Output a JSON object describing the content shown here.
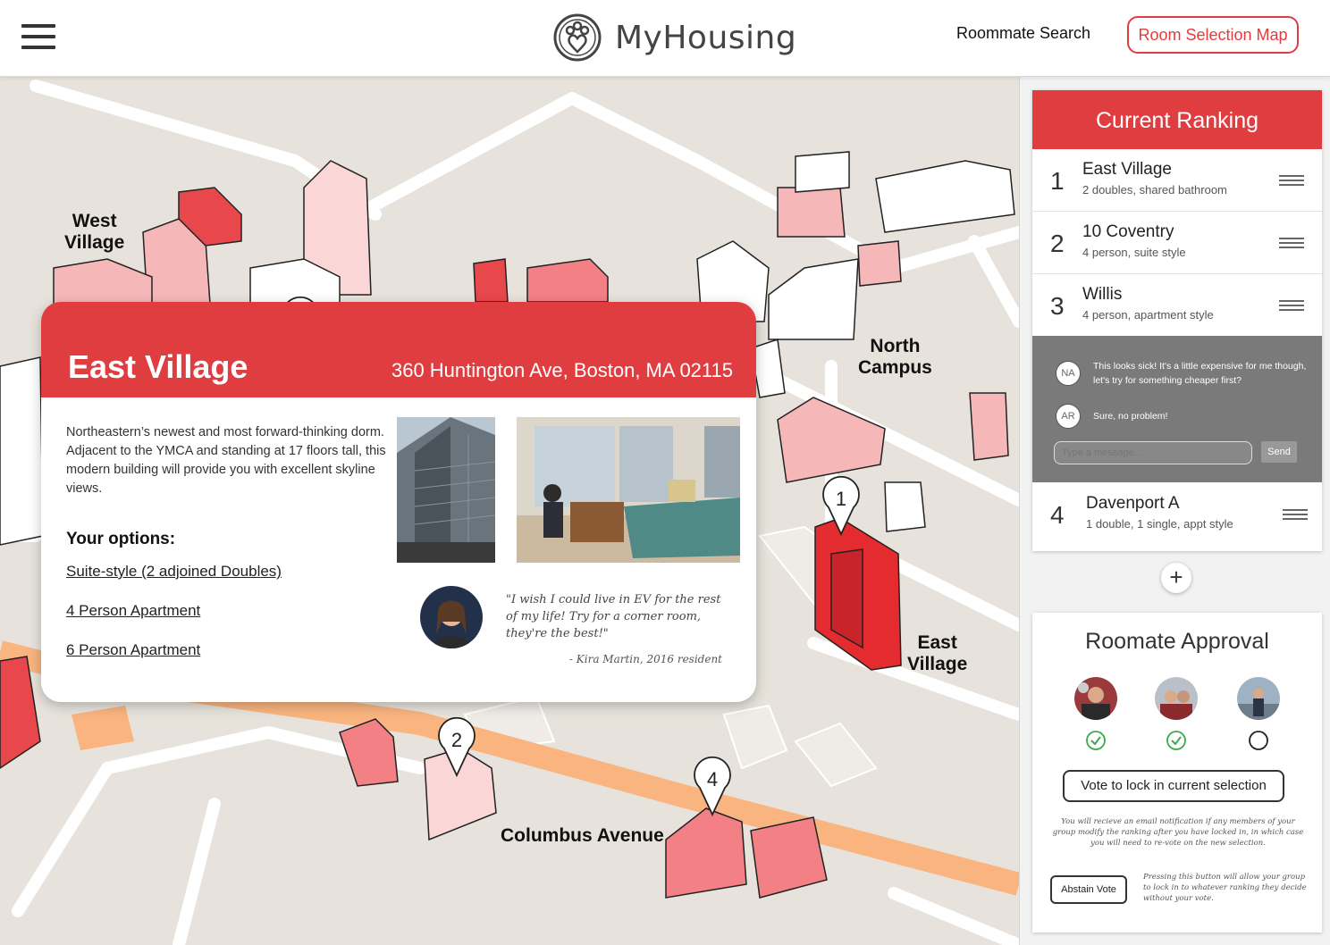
{
  "header": {
    "brand": "MyHousing",
    "nav_link": "Roommate Search",
    "nav_button": "Room Selection Map"
  },
  "map": {
    "labels": {
      "west_village": "West\nVillage",
      "north_campus": "North\nCampus",
      "east_village": "East\nVillage",
      "columbus": "Columbus Avenue"
    },
    "markers": [
      "1",
      "2",
      "4"
    ]
  },
  "card": {
    "title": "East Village",
    "address": "360 Huntington Ave, Boston, MA 02115",
    "description": "Northeastern’s newest and most forward-thinking dorm. Adjacent to the YMCA and standing at 17 floors tall, this modern building will provide you with excellent skyline views.",
    "options_title": "Your options:",
    "options": [
      "Suite-style (2 adjoined Doubles)",
      "4 Person Apartment",
      "6 Person Apartment"
    ],
    "quote": "\"I wish I could live in EV for the rest of my life! Try for a corner room, they're the best!\"",
    "quote_author": "- Kira Martin, 2016 resident"
  },
  "ranking": {
    "title": "Current Ranking",
    "items": [
      {
        "rank": "1",
        "name": "East Village",
        "detail": "2 doubles, shared bathroom"
      },
      {
        "rank": "2",
        "name": "10 Coventry",
        "detail": "4 person, suite style"
      },
      {
        "rank": "3",
        "name": "Willis",
        "detail": "4 person, apartment style"
      },
      {
        "rank": "4",
        "name": "Davenport A",
        "detail": "1 double, 1 single, appt style"
      }
    ],
    "chat": {
      "messages": [
        {
          "initials": "NA",
          "text": "This looks sick! It's a little expensive for me though, let's try for something cheaper first?"
        },
        {
          "initials": "AR",
          "text": "Sure, no problem!"
        }
      ],
      "placeholder": "Type a message...",
      "send": "Send"
    },
    "add": "+"
  },
  "approval": {
    "title": "Roomate Approval",
    "statuses": [
      "approved",
      "approved",
      "pending"
    ],
    "vote_button": "Vote to lock in current selection",
    "vote_note": "You will recieve an email notification if any members of your group modify the ranking after you have locked in, in which case you will need to re-vote on the new selection.",
    "abstain_button": "Abstain Vote",
    "abstain_note": "Pressing this button will allow your group to lock in to whatever ranking they decide without your vote."
  },
  "colors": {
    "accent": "#e03d40",
    "building_pink": "#f4a3a6",
    "building_light": "#f9d3d4",
    "road_orange": "#f9b47f",
    "approved": "#3aaa4a"
  }
}
